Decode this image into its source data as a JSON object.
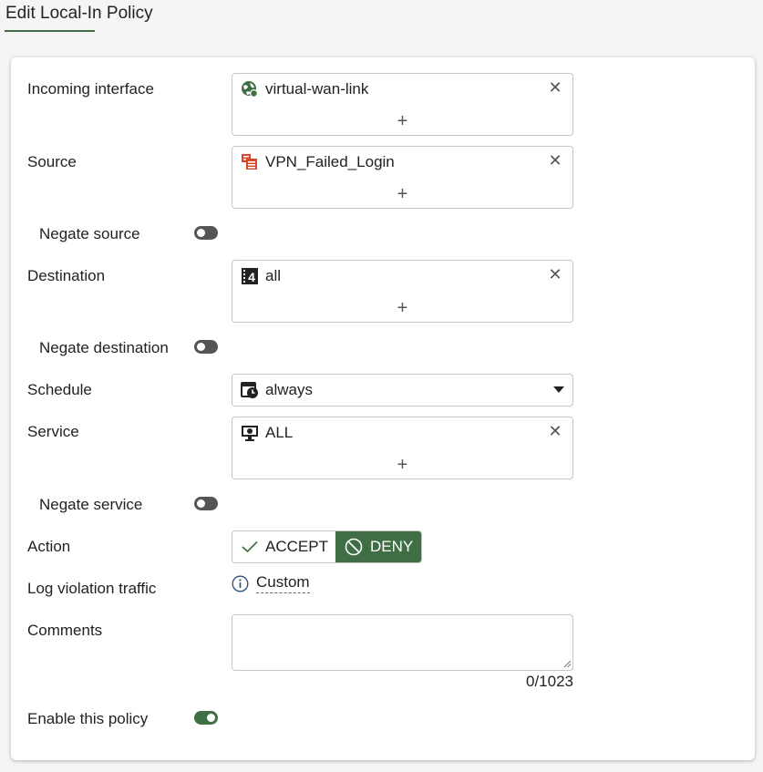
{
  "page": {
    "title": "Edit Local-In Policy"
  },
  "colors": {
    "accent": "#3f6e45",
    "toggle_off": "#555555",
    "source_icon": "#d9472b"
  },
  "form": {
    "incoming_interface": {
      "label": "Incoming interface",
      "value": "virtual-wan-link",
      "icon": "sd-wan-globe-icon"
    },
    "source": {
      "label": "Source",
      "value": "VPN_Failed_Login",
      "icon": "address-group-icon"
    },
    "negate_source": {
      "label": "Negate source",
      "enabled": false
    },
    "destination": {
      "label": "Destination",
      "value": "all",
      "icon": "ipv4-address-icon"
    },
    "negate_destination": {
      "label": "Negate destination",
      "enabled": false
    },
    "schedule": {
      "label": "Schedule",
      "value": "always",
      "icon": "schedule-clock-icon"
    },
    "service": {
      "label": "Service",
      "value": "ALL",
      "icon": "service-monitor-icon"
    },
    "negate_service": {
      "label": "Negate service",
      "enabled": false
    },
    "action": {
      "label": "Action",
      "options": [
        "ACCEPT",
        "DENY"
      ],
      "selected": "DENY"
    },
    "log_violation": {
      "label": "Log violation traffic",
      "value": "Custom",
      "icon": "info-circle-icon"
    },
    "comments": {
      "label": "Comments",
      "value": "",
      "counter": "0/1023"
    },
    "enable_policy": {
      "label": "Enable this policy",
      "enabled": true
    }
  }
}
